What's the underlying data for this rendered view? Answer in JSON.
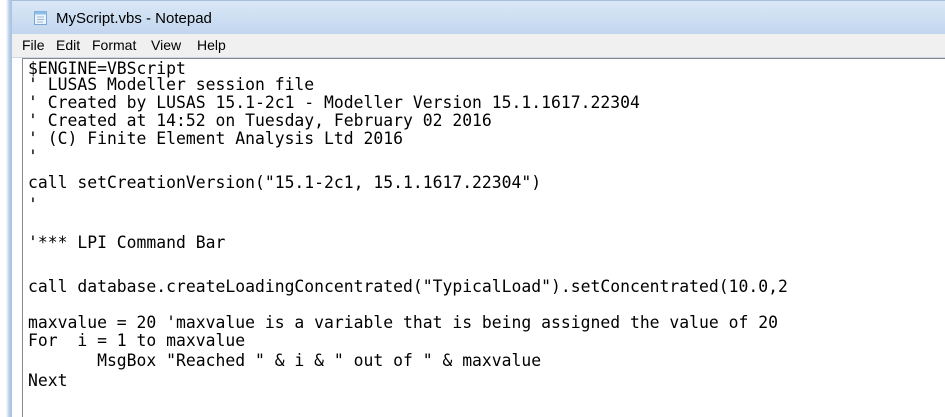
{
  "window": {
    "title": "MyScript.vbs - Notepad"
  },
  "menu": {
    "items": [
      "File",
      "Edit",
      "Format",
      "View",
      "Help"
    ]
  },
  "editor": {
    "lines": [
      "$ENGINE=VBScript",
      "' LUSAS Modeller session file",
      "' Created by LUSAS 15.1-2c1 - Modeller Version 15.1.1617.22304",
      "' Created at 14:52 on Tuesday, February 02 2016",
      "' (C) Finite Element Analysis Ltd 2016",
      "'",
      "call setCreationVersion(\"15.1-2c1, 15.1.1617.22304\")",
      "'",
      "",
      "'*** LPI Command Bar",
      "",
      "call database.createLoadingConcentrated(\"TypicalLoad\").setConcentrated(10.0,2",
      "",
      "maxvalue = 20 'maxvalue is a variable that is being assigned the value of 20",
      "For  i = 1 to maxvalue",
      "       MsgBox \"Reached \" & i & \" out of \" & maxvalue",
      "Next"
    ]
  },
  "icons": {
    "app": "notepad-icon"
  }
}
